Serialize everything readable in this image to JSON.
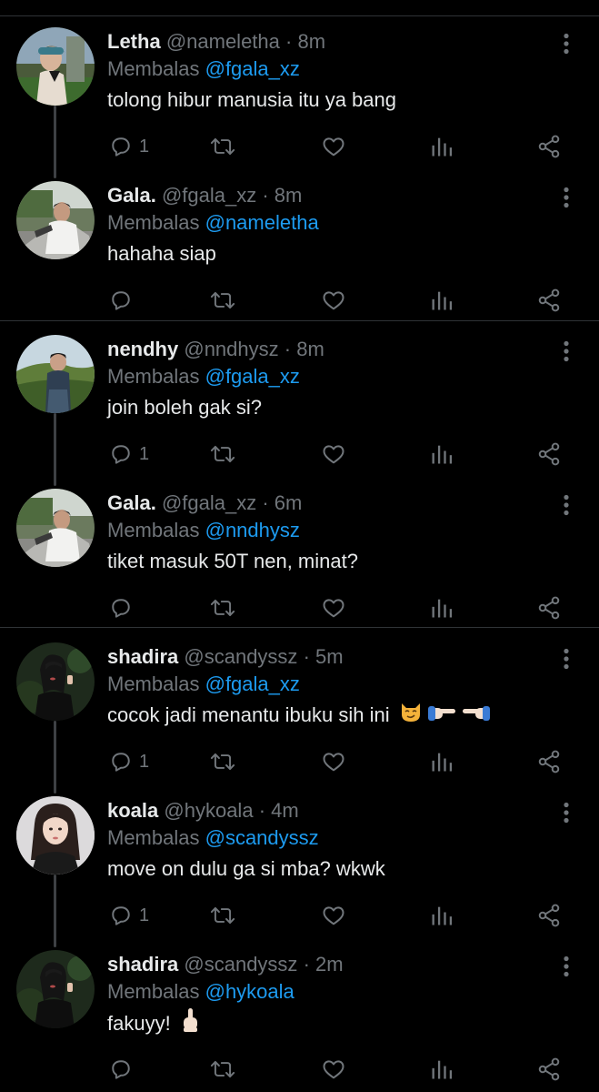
{
  "reply_prefix": "Membalas",
  "separator_dot": "·",
  "colors": {
    "background": "#000000",
    "text": "#e7e9ea",
    "muted": "#71767b",
    "accent": "#1d9bf0",
    "divider": "#2f3336"
  },
  "icons": [
    "reply-icon",
    "retweet-icon",
    "like-icon",
    "analytics-icon",
    "share-icon",
    "more-options-icon"
  ],
  "tweets": [
    {
      "name": "Letha",
      "handle": "@nameletha",
      "time": "8m",
      "replying_to": "@fgala_xz",
      "text": "tolong hibur manusia itu ya bang",
      "reply_count": "1",
      "avatar": "photo-avatar-letha"
    },
    {
      "name": "Gala.",
      "handle": "@fgala_xz",
      "time": "8m",
      "replying_to": "@nameletha",
      "text": "hahaha siap",
      "reply_count": "",
      "avatar": "photo-avatar-gala"
    },
    {
      "name": "nendhy",
      "handle": "@nndhysz",
      "time": "8m",
      "replying_to": "@fgala_xz",
      "text": "join boleh gak si?",
      "reply_count": "1",
      "avatar": "photo-avatar-nendhy"
    },
    {
      "name": "Gala.",
      "handle": "@fgala_xz",
      "time": "6m",
      "replying_to": "@nndhysz",
      "text": "tiket masuk 50T nen, minat?",
      "reply_count": "",
      "avatar": "photo-avatar-gala"
    },
    {
      "name": "shadira",
      "handle": "@scandyssz",
      "time": "5m",
      "replying_to": "@fgala_xz",
      "text": "cocok jadi menantu ibuku sih ini",
      "reply_count": "1",
      "avatar": "photo-avatar-shadira",
      "emoji": [
        "smirking-cat-emoji",
        "pointing-right-emoji",
        "pointing-left-emoji"
      ]
    },
    {
      "name": "koala",
      "handle": "@hykoala",
      "time": "4m",
      "replying_to": "@scandyssz",
      "text": "move on dulu ga si mba? wkwk",
      "reply_count": "1",
      "avatar": "photo-avatar-koala"
    },
    {
      "name": "shadira",
      "handle": "@scandyssz",
      "time": "2m",
      "replying_to": "@hykoala",
      "text": "fakuyy!",
      "reply_count": "",
      "avatar": "photo-avatar-shadira",
      "emoji": [
        "middle-finger-emoji"
      ]
    }
  ]
}
